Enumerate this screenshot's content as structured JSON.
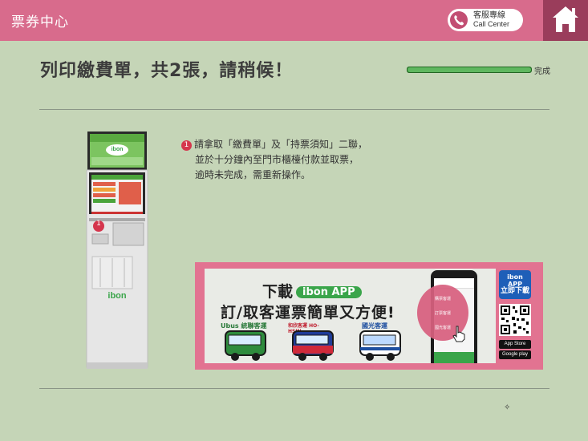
{
  "header": {
    "title": "票券中心",
    "call_center_zh": "客服專線",
    "call_center_en": "Call Center"
  },
  "main": {
    "title": "列印繳費單，共2張，請稍候！",
    "progress": {
      "value_percent": 100,
      "label": "完成"
    }
  },
  "instruction": {
    "step_number": "1",
    "lines": [
      "請拿取「繳費單」及「持票須知」二聯，",
      "並於十分鐘內至門市櫃檯付款並取票，",
      "逾時未完成，需重新操作。"
    ]
  },
  "kiosk": {
    "brand": "ibon",
    "slot_number": "1"
  },
  "banner": {
    "line1_prefix": "下載",
    "line1_app": "ibon APP",
    "line2": "訂/取客運票簡單又方便!",
    "bus_logos": [
      "Ubus 統聯客運",
      "和欣客運 HO-HSIN",
      "國光客運"
    ],
    "phone_menu": [
      "購票客運",
      "訂票客運",
      "國光客運"
    ],
    "badge_line1": "ibon APP",
    "badge_line2": "立即下載",
    "store_apple": "App Store",
    "store_google": "Google play"
  },
  "colors": {
    "background": "#c5d5b7",
    "header": "#d86b8c",
    "home": "#9a3d5b",
    "progress": "#5fb75f",
    "banner": "#e27391"
  },
  "icons": {
    "call": "phone-icon",
    "home": "home-icon",
    "sparkle": "sparkle-icon"
  }
}
